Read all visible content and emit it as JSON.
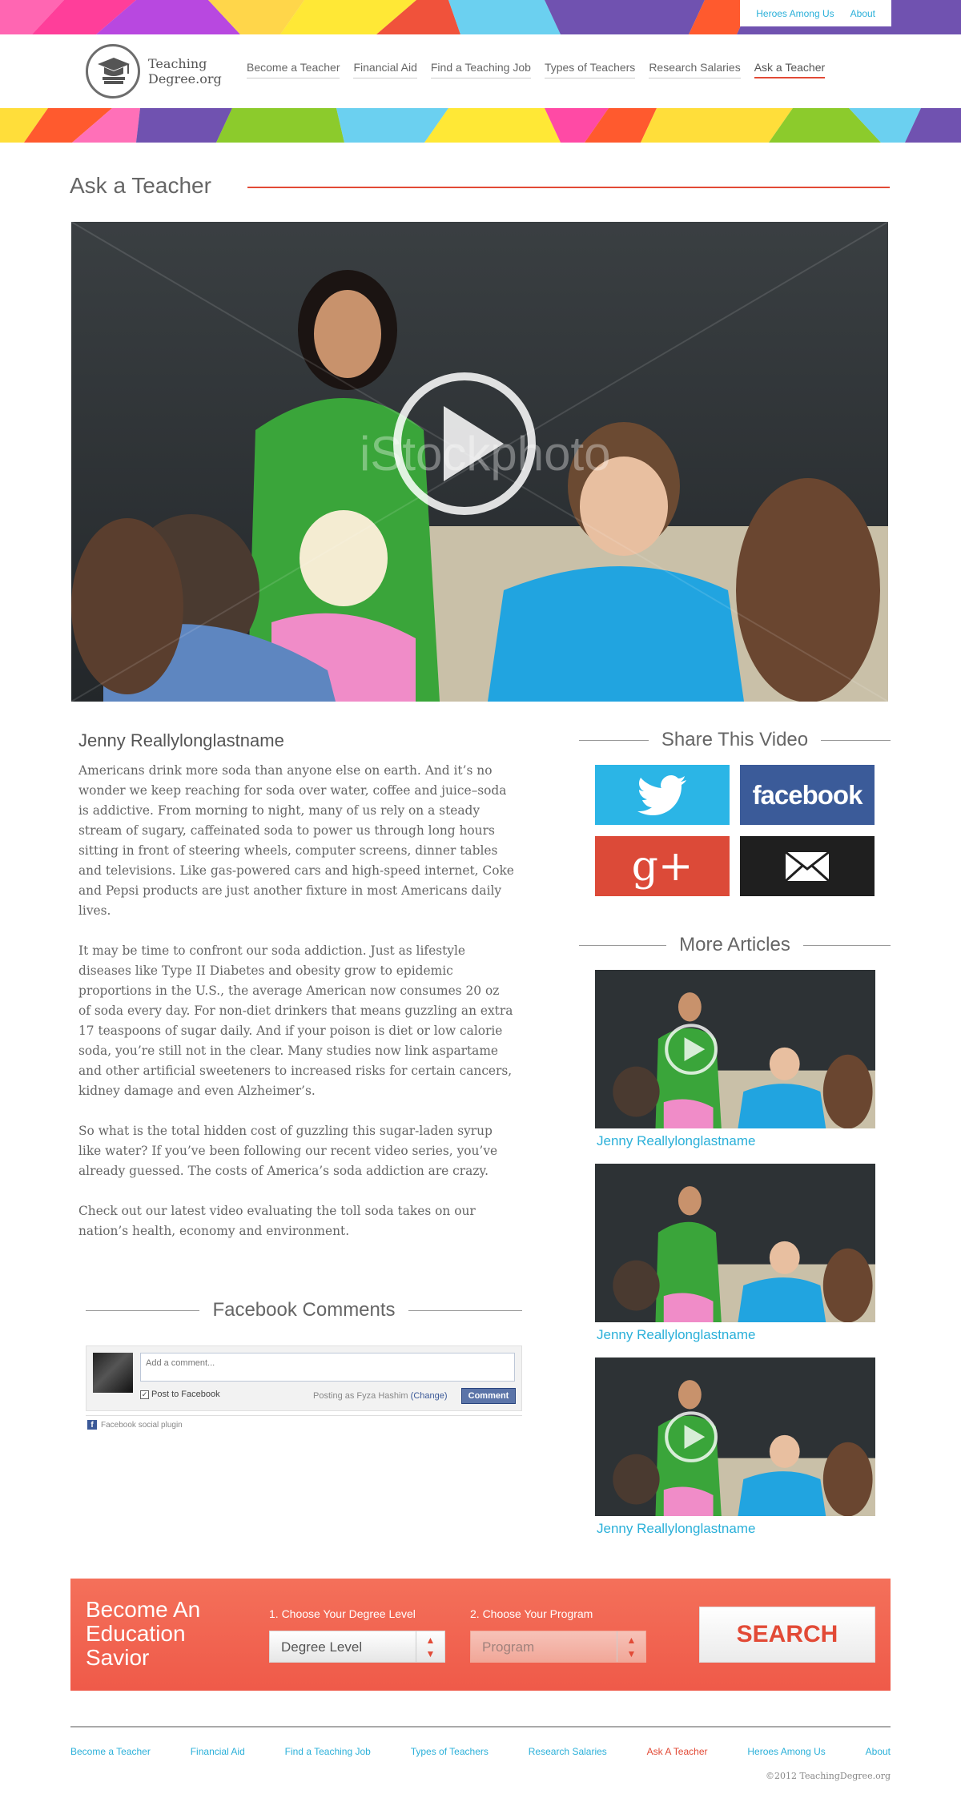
{
  "top_links": [
    "Heroes Among Us",
    "About"
  ],
  "logo": {
    "line1": "Teaching",
    "line2": "Degree.org"
  },
  "nav": [
    "Become a Teacher",
    "Financial Aid",
    "Find a Teaching Job",
    "Types of Teachers",
    "Research Salaries",
    "Ask a Teacher"
  ],
  "nav_active": "Ask a Teacher",
  "page_title": "Ask a Teacher",
  "video_watermark": "iStockphoto",
  "author": "Jenny Reallylonglastname",
  "article": [
    "Americans drink more soda than anyone else on earth. And it’s no wonder we keep reaching for soda over water, coffee and juice–soda is addictive. From morning to night, many of us rely on a steady stream of sugary, caffeinated soda to power us through long hours sitting in front of steering wheels, computer screens, dinner tables and televisions. Like gas-powered cars and high-speed internet, Coke and Pepsi products are just another fixture in most Americans daily lives.",
    "It may be time to confront our soda addiction. Just as lifestyle diseases like Type II Diabetes and obesity grow to epidemic proportions in the U.S., the average American now consumes 20 oz of soda every day. For non-diet drinkers that means guzzling an extra 17 teaspoons of sugar daily. And if your poison is diet or low calorie soda, you’re still not in the clear. Many studies now link aspartame and other artificial sweeteners to increased risks for certain cancers, kidney damage and even Alzheimer’s.",
    "So what is the total hidden cost of guzzling this sugar-laden syrup like water? If you’ve been following our recent video series, you’ve already guessed. The costs of America’s soda addiction are crazy.",
    "Check out our latest video evaluating the toll soda takes on our nation’s health, economy and environment."
  ],
  "comments": {
    "heading": "Facebook Comments",
    "placeholder": "Add a comment...",
    "post_to_facebook": "Post to Facebook",
    "posting_as": "Posting as Fyza Hashim",
    "change": "(Change)",
    "button": "Comment",
    "plugin": "Facebook social plugin"
  },
  "share": {
    "heading": "Share This Video",
    "facebook_label": "facebook",
    "google_label": "g+"
  },
  "more": {
    "heading": "More Articles",
    "items": [
      "Jenny Reallylonglastname",
      "Jenny Reallylonglastname",
      "Jenny Reallylonglastname"
    ]
  },
  "promo": {
    "title": "Become An Education Savior",
    "step1": "1. Choose Your Degree Level",
    "step2": "2. Choose Your Program",
    "select1": "Degree Level",
    "select2": "Program",
    "search": "SEARCH"
  },
  "footer": {
    "links": [
      "Become a Teacher",
      "Financial Aid",
      "Find a Teaching Job",
      "Types of Teachers",
      "Research Salaries",
      "Ask A Teacher",
      "Heroes Among Us",
      "About"
    ],
    "active": "Ask A Teacher",
    "copyright": "©2012 TeachingDegree.org"
  },
  "colors": {
    "accent": "#e24a36",
    "link": "#2bb0d9",
    "twitter": "#2bb5e6",
    "facebook": "#3b5b99",
    "google": "#dc4a38",
    "email": "#1f1f1f",
    "promo": "#ef5a49"
  }
}
